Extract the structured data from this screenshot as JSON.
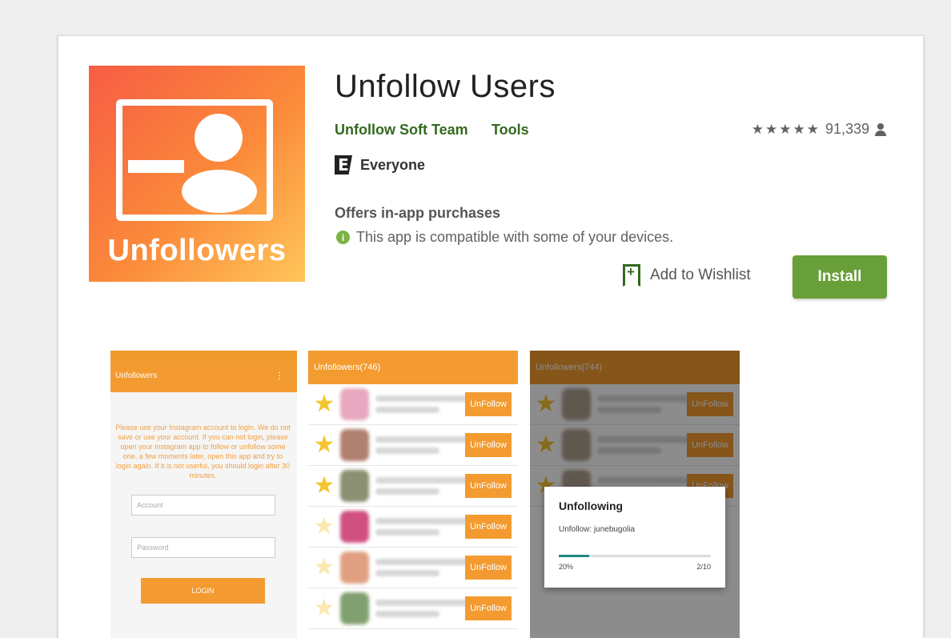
{
  "app": {
    "icon_text": "Unfollowers",
    "title": "Unfollow Users",
    "developer": "Unfollow Soft Team",
    "category": "Tools",
    "rating_stars": "★★★★★",
    "rating_count": "91,339",
    "content_rating_icon": "E",
    "content_rating": "Everyone",
    "in_app": "Offers in-app purchases",
    "compatibility": "This app is compatible with some of your devices.",
    "info_icon_glyph": "i",
    "wishlist_label": "Add to Wishlist",
    "install_label": "Install"
  },
  "colors": {
    "accent_green": "#689f38",
    "link_green": "#33691e",
    "orange": "#f39b30"
  },
  "screenshot1": {
    "bar_title": "Unfollowers",
    "menu_glyph": "⋮",
    "body_text": "Please use your Instagram account to login. We do not save or use your account. If you can not login, please open your Instagram app to follow or unfollow some one, a few moments later, open this app and try to login again. If it is not userful, you should login after 30 minutes.",
    "account_placeholder": "Account",
    "password_placeholder": "Password",
    "login_label": "LOGIN"
  },
  "screenshot2": {
    "bar_title": "Unfollowers(746)",
    "rows": [
      {
        "btn": "UnFollow",
        "star": "★",
        "avatar": "#e8a8c0"
      },
      {
        "btn": "UnFollow",
        "star": "★",
        "avatar": "#b08070"
      },
      {
        "btn": "UnFollow",
        "star": "★",
        "avatar": "#8a9070"
      },
      {
        "btn": "UnFollow",
        "star": "★",
        "avatar": "#d05080"
      },
      {
        "btn": "UnFollow",
        "star": "★",
        "avatar": "#e0a080"
      },
      {
        "btn": "UnFollow",
        "star": "★",
        "avatar": "#80a070"
      }
    ]
  },
  "screenshot3": {
    "bar_title": "Unfollowers(744)",
    "rows": [
      {
        "btn": "UnFollow",
        "star": "★"
      },
      {
        "btn": "UnFollow",
        "star": "★"
      },
      {
        "btn": "UnFollow",
        "star": "★"
      }
    ],
    "dialog_title": "Unfollowing",
    "dialog_message": "Unfollow: junebugolia",
    "progress_label": "20%",
    "progress_fraction": 0.2,
    "progress_count": "2/10"
  }
}
